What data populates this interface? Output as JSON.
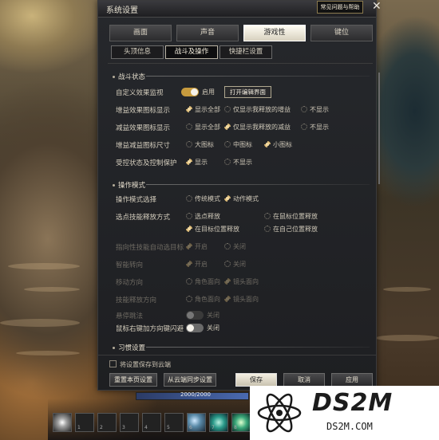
{
  "window": {
    "title": "系统设置",
    "help_label": "常见问题与帮助",
    "close_glyph": "✕"
  },
  "tabs": [
    {
      "label": "画面",
      "active": false
    },
    {
      "label": "声音",
      "active": false
    },
    {
      "label": "游戏性",
      "active": true
    },
    {
      "label": "键位",
      "active": false
    }
  ],
  "subtabs": [
    {
      "label": "头顶信息",
      "active": false
    },
    {
      "label": "战斗及操作",
      "active": true
    },
    {
      "label": "快捷栏设置",
      "active": false
    }
  ],
  "sections": {
    "combat": {
      "title": "战斗状态",
      "custom_monitor": {
        "label": "自定义效果监视",
        "toggle_on": true,
        "toggle_text": "启用",
        "button": "打开编辑界面"
      },
      "buff_display": {
        "label": "增益效果图标显示",
        "options": [
          "显示全部",
          "仅显示我释放的增益",
          "不显示"
        ],
        "selected": 0
      },
      "debuff_display": {
        "label": "减益效果图标显示",
        "options": [
          "显示全部",
          "仅显示我释放的减益",
          "不显示"
        ],
        "selected": 1
      },
      "icon_size": {
        "label": "增益减益图标尺寸",
        "options": [
          "大图标",
          "中图标",
          "小图标"
        ],
        "selected": 2
      },
      "cc_protect": {
        "label": "受控状态及控制保护",
        "options": [
          "显示",
          "不显示"
        ],
        "selected": 0
      }
    },
    "operation": {
      "title": "操作模式",
      "mode": {
        "label": "操作模式选择",
        "options": [
          "传统模式",
          "动作模式"
        ],
        "selected": 1
      },
      "target_cast": {
        "label": "选点技能释放方式",
        "options": [
          "选点释放",
          "在鼠标位置释放",
          "在目标位置释放",
          "在自己位置释放"
        ],
        "selected": 2
      },
      "auto_target": {
        "label": "指向性技能自动选目标",
        "options": [
          "开启",
          "关闭"
        ],
        "selected": 0,
        "disabled": true
      },
      "smart_turn": {
        "label": "智能转向",
        "options": [
          "开启",
          "关闭"
        ],
        "selected": 0,
        "disabled": true
      },
      "move_dir": {
        "label": "移动方向",
        "options": [
          "角色面向",
          "镜头面向"
        ],
        "selected": 1,
        "disabled": true
      },
      "skill_dir": {
        "label": "技能释放方向",
        "options": [
          "角色面向",
          "镜头面向"
        ],
        "selected": 1,
        "disabled": true
      },
      "hover_fly": {
        "label": "悬停跳法",
        "toggle_on": false,
        "toggle_text": "关闭",
        "disabled": true
      },
      "right_click_dodge": {
        "label": "鼠标右键加方向键闪避",
        "toggle_on": false,
        "toggle_text": "关闭"
      }
    },
    "habits": {
      "title": "习惯设置"
    }
  },
  "footer": {
    "save_cloud": "将设置保存到云端",
    "reset_page": "重置本页设置",
    "cloud_sync": "从云端同步设置",
    "save": "保存",
    "cancel": "取消",
    "apply": "应用"
  },
  "hud": {
    "hp_text": "2000/2000",
    "slot_keys": [
      "1",
      "2",
      "3",
      "4",
      "5",
      "6",
      "7",
      "8"
    ]
  },
  "watermark": {
    "title": "DS2M",
    "url": "DS2M.COM"
  },
  "colors": {
    "accent_gold": "#c79b3e",
    "active_tab": "#fffdf4"
  }
}
